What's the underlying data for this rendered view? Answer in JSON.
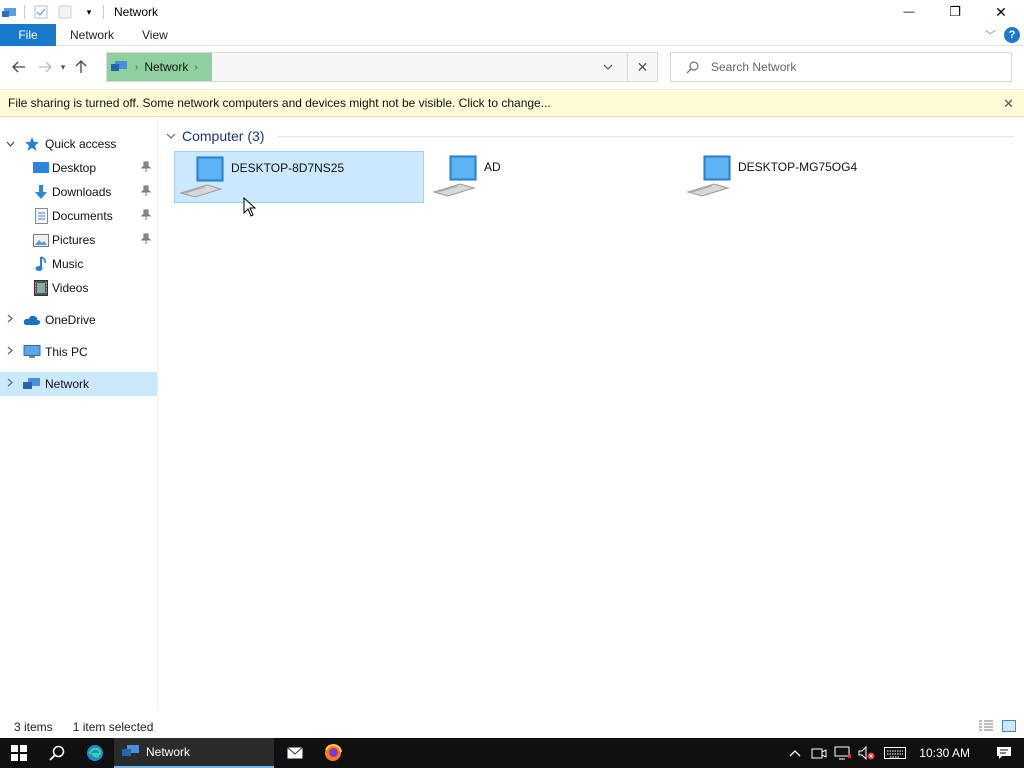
{
  "window": {
    "title": "Network",
    "controls": {
      "minimize": "—",
      "restore": "❐",
      "close": "✕"
    }
  },
  "ribbon": {
    "tabs": [
      "File",
      "Network",
      "View"
    ]
  },
  "address": {
    "crumb": "Network",
    "clear_symbol": "✕"
  },
  "search": {
    "placeholder": "Search Network"
  },
  "infobar": {
    "message": "File sharing is turned off. Some network computers and devices might not be visible. Click to change...",
    "close_symbol": "✕"
  },
  "navpane": {
    "quick_access": "Quick access",
    "items": [
      {
        "label": "Desktop",
        "icon": "desktop-icon",
        "pinned": true
      },
      {
        "label": "Downloads",
        "icon": "downloads-icon",
        "pinned": true
      },
      {
        "label": "Documents",
        "icon": "documents-icon",
        "pinned": true
      },
      {
        "label": "Pictures",
        "icon": "pictures-icon",
        "pinned": true
      },
      {
        "label": "Music",
        "icon": "music-icon",
        "pinned": false
      },
      {
        "label": "Videos",
        "icon": "videos-icon",
        "pinned": false
      }
    ],
    "onedrive": "OneDrive",
    "thispc": "This PC",
    "network": "Network"
  },
  "content": {
    "group_title": "Computer (3)",
    "computers": [
      {
        "name": "DESKTOP-8D7NS25",
        "selected": true
      },
      {
        "name": "AD",
        "selected": false
      },
      {
        "name": "DESKTOP-MG75OG4",
        "selected": false
      }
    ]
  },
  "status": {
    "items": "3 items",
    "selected": "1 item selected"
  },
  "taskbar": {
    "active_window": "Network",
    "time": "10:30 AM"
  },
  "colors": {
    "accent": "#1979ca",
    "selection": "#cce8ff",
    "infobar": "#fffbd6",
    "crumb_highlight": "#8fd19e",
    "taskbar": "#101010"
  }
}
